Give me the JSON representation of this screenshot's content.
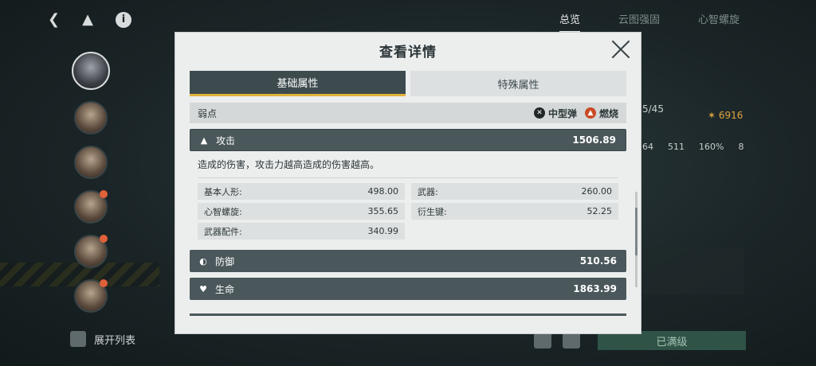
{
  "background": {
    "top_tabs": [
      "总览",
      "云图强固",
      "心智螺旋"
    ],
    "expand_list_label": "展开列表",
    "mastered_button": "已满级",
    "stat_partial": "5/45",
    "gold_value": "6916",
    "stats_row": [
      "64",
      "511",
      "160%",
      "8"
    ]
  },
  "modal": {
    "title": "查看详情",
    "tabs": [
      {
        "label": "基础属性",
        "active": true
      },
      {
        "label": "特殊属性",
        "active": false
      }
    ],
    "weakness": {
      "label": "弱点",
      "tags": [
        {
          "icon": "bullet-icon",
          "label": "中型弹"
        },
        {
          "icon": "fire-icon",
          "label": "燃烧"
        }
      ]
    },
    "attack": {
      "label": "攻击",
      "value": "1506.89",
      "description": "造成的伤害，攻击力越高造成的伤害越高。",
      "breakdown": [
        {
          "label": "基本人形:",
          "value": "498.00"
        },
        {
          "label": "武器:",
          "value": "260.00"
        },
        {
          "label": "心智螺旋:",
          "value": "355.65"
        },
        {
          "label": "衍生键:",
          "value": "52.25"
        },
        {
          "label": "武器配件:",
          "value": "340.99"
        }
      ]
    },
    "defense": {
      "label": "防御",
      "value": "510.56"
    },
    "health": {
      "label": "生命",
      "value": "1863.99"
    }
  },
  "colors": {
    "tab_active_bg": "#3d4b4f",
    "tab_accent": "#e2b23a",
    "stat_bar_bg": "#4a575b",
    "modal_bg": "#eceeee"
  }
}
